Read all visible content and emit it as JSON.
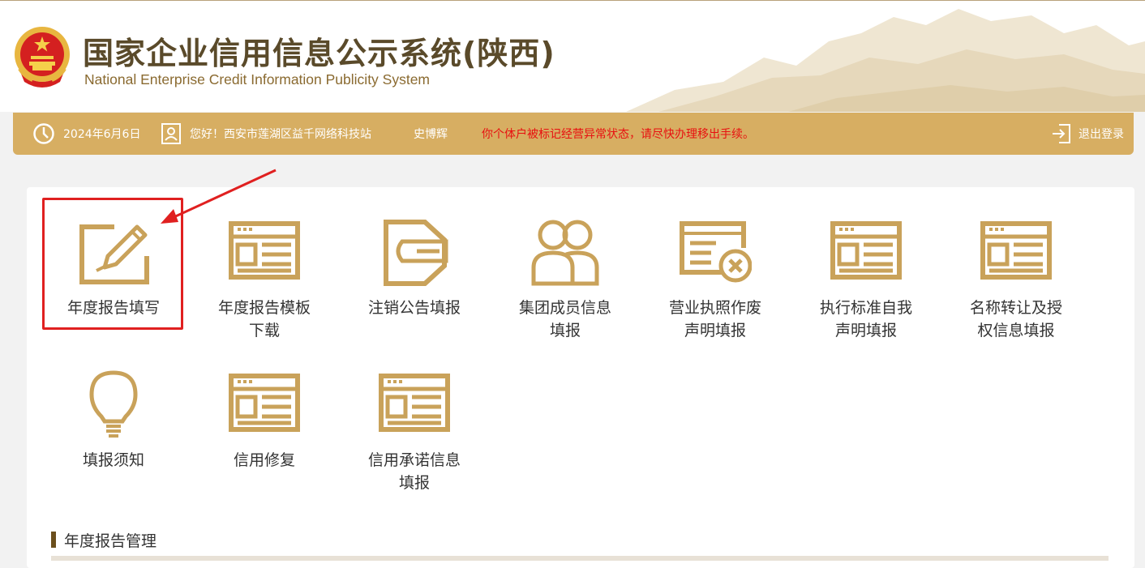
{
  "header": {
    "title_cn": "国家企业信用信息公示系统(陕西)",
    "title_en": "National Enterprise Credit Information Publicity System"
  },
  "infobar": {
    "date": "2024年6月6日",
    "greeting": "您好！西安市莲湖区益千网络科技站",
    "user": "史博辉",
    "warning": "你个体户被标记经营异常状态，请尽快办理移出手续。",
    "logout": "退出登录"
  },
  "tiles": [
    {
      "label": "年度报告填写",
      "icon": "edit-icon"
    },
    {
      "label": "年度报告模板下载",
      "icon": "document-icon"
    },
    {
      "label": "注销公告填报",
      "icon": "cancel-notice-icon"
    },
    {
      "label": "集团成员信息填报",
      "icon": "group-members-icon"
    },
    {
      "label": "营业执照作废声明填报",
      "icon": "license-void-icon"
    },
    {
      "label": "执行标准自我声明填报",
      "icon": "document-icon"
    },
    {
      "label": "名称转让及授权信息填报",
      "icon": "document-icon"
    },
    {
      "label": "填报须知",
      "icon": "lightbulb-icon"
    },
    {
      "label": "信用修复",
      "icon": "document-icon"
    },
    {
      "label": "信用承诺信息填报",
      "icon": "document-icon"
    }
  ],
  "section": {
    "title": "年度报告管理"
  },
  "colors": {
    "gold": "#d7ae62",
    "icon_gold": "#c9a25a",
    "warning": "#e81010",
    "highlight": "#e02020"
  }
}
